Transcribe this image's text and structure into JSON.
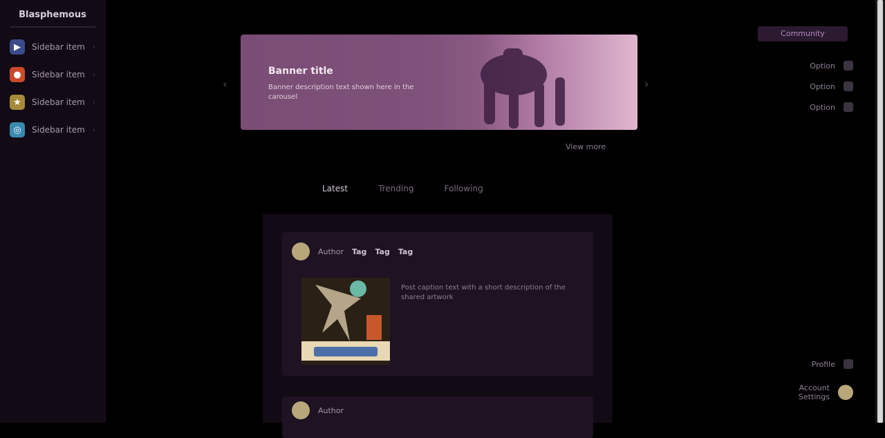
{
  "sidebar": {
    "title": "Blasphemous",
    "items": [
      {
        "label": "Sidebar item",
        "icon": "gamepad-icon",
        "color": "#3b4a8a"
      },
      {
        "label": "Sidebar item",
        "icon": "flame-icon",
        "color": "#c94a2a"
      },
      {
        "label": "Sidebar item",
        "icon": "trophy-icon",
        "color": "#a58a3a"
      },
      {
        "label": "Sidebar item",
        "icon": "globe-icon",
        "color": "#3a8ab0"
      }
    ]
  },
  "banner": {
    "title": "Banner title",
    "description": "Banner description text shown here in the carousel",
    "link": "View more"
  },
  "tabs": [
    {
      "label": "Latest",
      "active": true
    },
    {
      "label": "Trending",
      "active": false
    },
    {
      "label": "Following",
      "active": false
    }
  ],
  "posts": [
    {
      "author": "Author",
      "tags": [
        "Tag",
        "Tag",
        "Tag"
      ],
      "text": "Post caption text with a short description of the shared artwork"
    },
    {
      "author": "Author",
      "tags": []
    }
  ],
  "right_panel": {
    "button": "Community",
    "options": [
      "Option",
      "Option",
      "Option"
    ],
    "profile": "Profile",
    "account": [
      "Account",
      "Settings"
    ]
  },
  "colors": {
    "accent": "#b28cc0",
    "background": "#000000",
    "sidebar": "#120a14"
  }
}
